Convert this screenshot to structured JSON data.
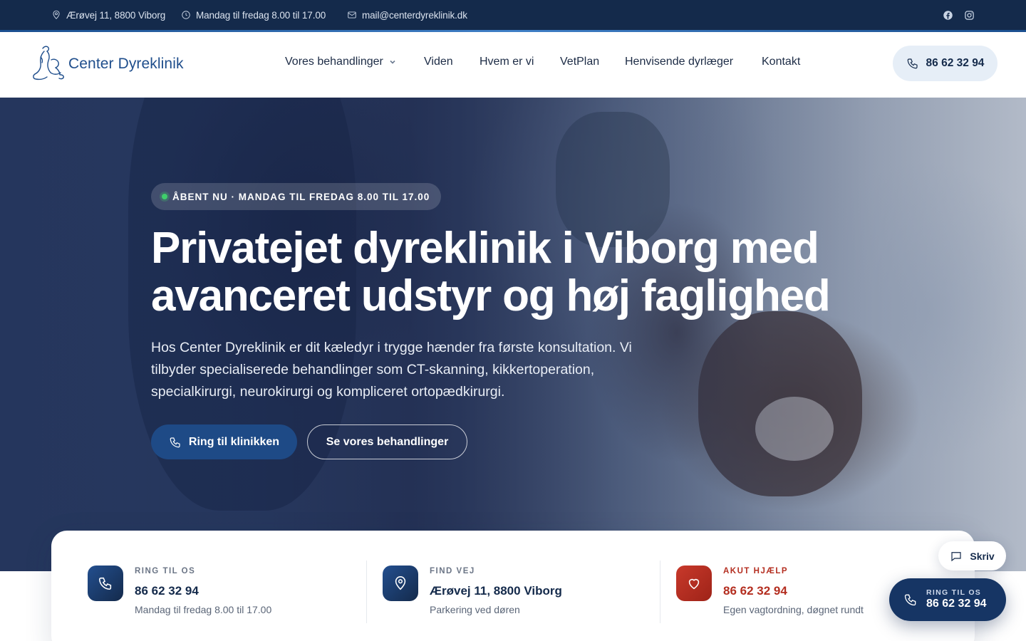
{
  "topbar": {
    "address": "Ærøvej 11, 8800 Viborg",
    "hours": "Mandag til fredag 8.00 til 17.00",
    "email": "mail@centerdyreklinik.dk",
    "social": [
      "facebook-icon",
      "instagram-icon"
    ]
  },
  "header": {
    "logo_text": "Center Dyreklinik",
    "nav": [
      {
        "label": "Vores behandlinger",
        "has_dropdown": true
      },
      {
        "label": "Viden"
      },
      {
        "label": "Hvem er vi"
      },
      {
        "label": "VetPlan"
      },
      {
        "label": "Henvisende dyrlæger"
      },
      {
        "label": "Kontakt"
      }
    ],
    "phone": "86 62 32 94"
  },
  "hero": {
    "badge": "ÅBENT NU · MANDAG TIL FREDAG 8.00 TIL 17.00",
    "title": "Privatejet dyreklinik i Viborg med avanceret udstyr og høj faglighed",
    "text": "Hos Center Dyreklinik er dit kæledyr i trygge hænder fra første konsultation. Vi tilbyder specialiserede behandlinger som CT-skanning, kikkertoperation, specialkirurgi, neurokirurgi og kompliceret ortopædkirurgi.",
    "primary_button": "Ring til klinikken",
    "secondary_button": "Se vores behandlinger"
  },
  "info": [
    {
      "label": "RING TIL OS",
      "value": "86 62 32 94",
      "sub": "Mandag til fredag 8.00 til 17.00",
      "icon": "phone-icon"
    },
    {
      "label": "FIND VEJ",
      "value": "Ærøvej 11, 8800 Viborg",
      "sub": "Parkering ved døren",
      "icon": "map-pin-icon"
    },
    {
      "label": "AKUT HJÆLP",
      "value": "86 62 32 94",
      "sub": "Egen vagtordning, døgnet rundt",
      "icon": "heart-icon"
    }
  ],
  "widgets": {
    "chat_label": "Skriv",
    "call_label": "RING TIL OS",
    "call_number": "86 62 32 94"
  },
  "colors": {
    "navy": "#142a4b",
    "brand_blue": "#1f4e8c",
    "accent_red": "#b42e20",
    "open_green": "#3fcf6b"
  }
}
